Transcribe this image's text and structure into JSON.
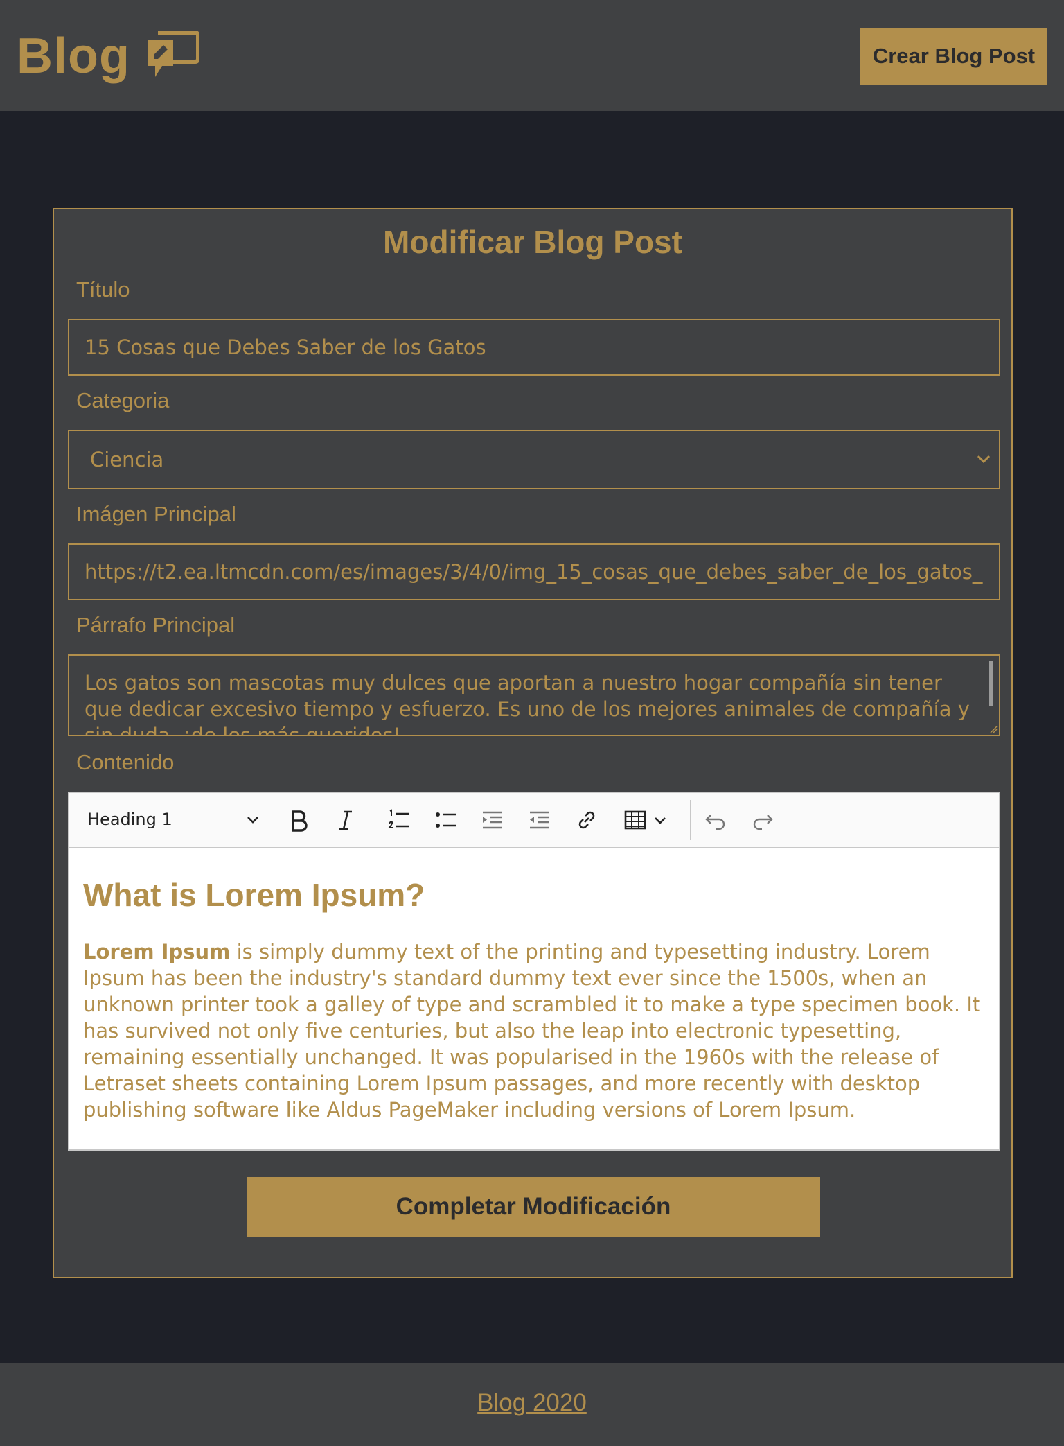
{
  "header": {
    "logo_text": "Blog",
    "logo_icon": "chat-bubble-icon",
    "create_button": "Crear Blog Post"
  },
  "form": {
    "title": "Modificar Blog Post",
    "titulo": {
      "label": "Título",
      "value": "15 Cosas que Debes Saber de los Gatos"
    },
    "categoria": {
      "label": "Categoria",
      "selected": "Ciencia"
    },
    "imagen": {
      "label": "Imágen Principal",
      "value": "https://t2.ea.ltmcdn.com/es/images/3/4/0/img_15_cosas_que_debes_saber_de_los_gatos_"
    },
    "parrafo": {
      "label": "Párrafo Principal",
      "value": "Los gatos son mascotas muy dulces que aportan a nuestro hogar compañía sin tener que dedicar excesivo tiempo y esfuerzo. Es uno de los mejores animales de compañía y sin duda, ¡de los más queridos!"
    },
    "contenido": {
      "label": "Contenido",
      "toolbar": {
        "heading_select": "Heading 1",
        "buttons": [
          "bold-icon",
          "italic-icon",
          "numbered-list-icon",
          "bulleted-list-icon",
          "indent-icon",
          "outdent-icon",
          "link-icon",
          "table-icon",
          "undo-icon",
          "redo-icon"
        ]
      },
      "heading": "What is Lorem Ipsum?",
      "paragraph_bold": "Lorem Ipsum",
      "paragraph_rest": " is simply dummy text of the printing and typesetting industry. Lorem Ipsum has been the industry's standard dummy text ever since the 1500s, when an unknown printer took a galley of type and scrambled it to make a type specimen book. It has survived not only five centuries, but also the leap into electronic typesetting, remaining essentially unchanged. It was popularised in the 1960s with the release of Letraset sheets containing Lorem Ipsum passages, and more recently with desktop publishing software like Aldus PageMaker including versions of Lorem Ipsum."
    },
    "submit_button": "Completar Modificación"
  },
  "footer": {
    "link": "Blog 2020"
  },
  "colors": {
    "accent": "#b28f4c",
    "page_bg": "#1e2028",
    "panel_bg": "#404143",
    "editor_bg": "#ffffff"
  }
}
